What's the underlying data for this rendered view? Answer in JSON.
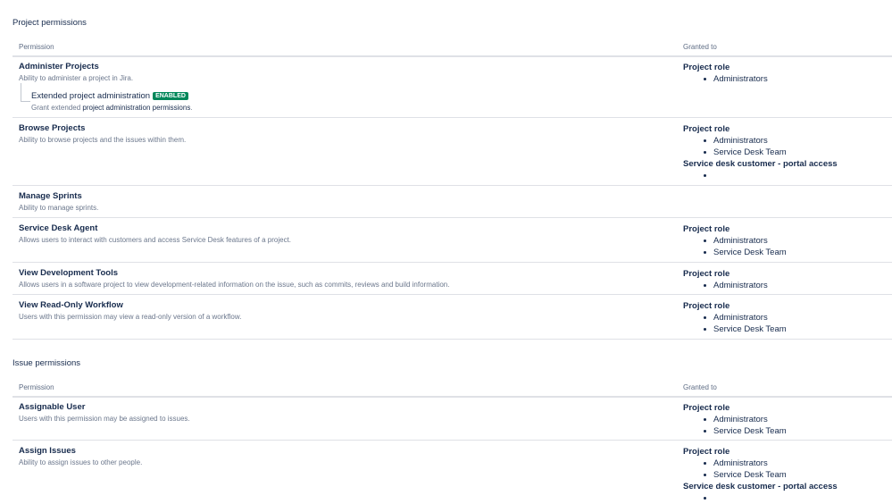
{
  "project_permissions": {
    "title": "Project permissions",
    "header": {
      "permission": "Permission",
      "granted_to": "Granted to"
    },
    "rows": [
      {
        "name": "Administer Projects",
        "description": "Ability to administer a project in Jira.",
        "sub": {
          "name": "Extended project administration",
          "badge": "ENABLED",
          "desc_prefix": "Grant extended ",
          "desc_link": "project administration permissions",
          "desc_suffix": "."
        },
        "grants": [
          {
            "label": "Project role",
            "items": [
              "Administrators"
            ]
          }
        ]
      },
      {
        "name": "Browse Projects",
        "description": "Ability to browse projects and the issues within them.",
        "grants": [
          {
            "label": "Project role",
            "items": [
              "Administrators",
              "Service Desk Team"
            ]
          },
          {
            "label": "Service desk customer - portal access",
            "items": [
              ""
            ]
          }
        ]
      },
      {
        "name": "Manage Sprints",
        "description": "Ability to manage sprints.",
        "grants": []
      },
      {
        "name": "Service Desk Agent",
        "description": "Allows users to interact with customers and access Service Desk features of a project.",
        "grants": [
          {
            "label": "Project role",
            "items": [
              "Administrators",
              "Service Desk Team"
            ]
          }
        ]
      },
      {
        "name": "View Development Tools",
        "description": "Allows users in a software project to view development-related information on the issue, such as commits, reviews and build information.",
        "grants": [
          {
            "label": "Project role",
            "items": [
              "Administrators"
            ]
          }
        ]
      },
      {
        "name": "View Read-Only Workflow",
        "description": "Users with this permission may view a read-only version of a workflow.",
        "grants": [
          {
            "label": "Project role",
            "items": [
              "Administrators",
              "Service Desk Team"
            ]
          }
        ]
      }
    ]
  },
  "issue_permissions": {
    "title": "Issue permissions",
    "header": {
      "permission": "Permission",
      "granted_to": "Granted to"
    },
    "rows": [
      {
        "name": "Assignable User",
        "description": "Users with this permission may be assigned to issues.",
        "grants": [
          {
            "label": "Project role",
            "items": [
              "Administrators",
              "Service Desk Team"
            ]
          }
        ]
      },
      {
        "name": "Assign Issues",
        "description": "Ability to assign issues to other people.",
        "grants": [
          {
            "label": "Project role",
            "items": [
              "Administrators",
              "Service Desk Team"
            ]
          },
          {
            "label": "Service desk customer - portal access",
            "items": [
              ""
            ]
          }
        ]
      }
    ]
  }
}
